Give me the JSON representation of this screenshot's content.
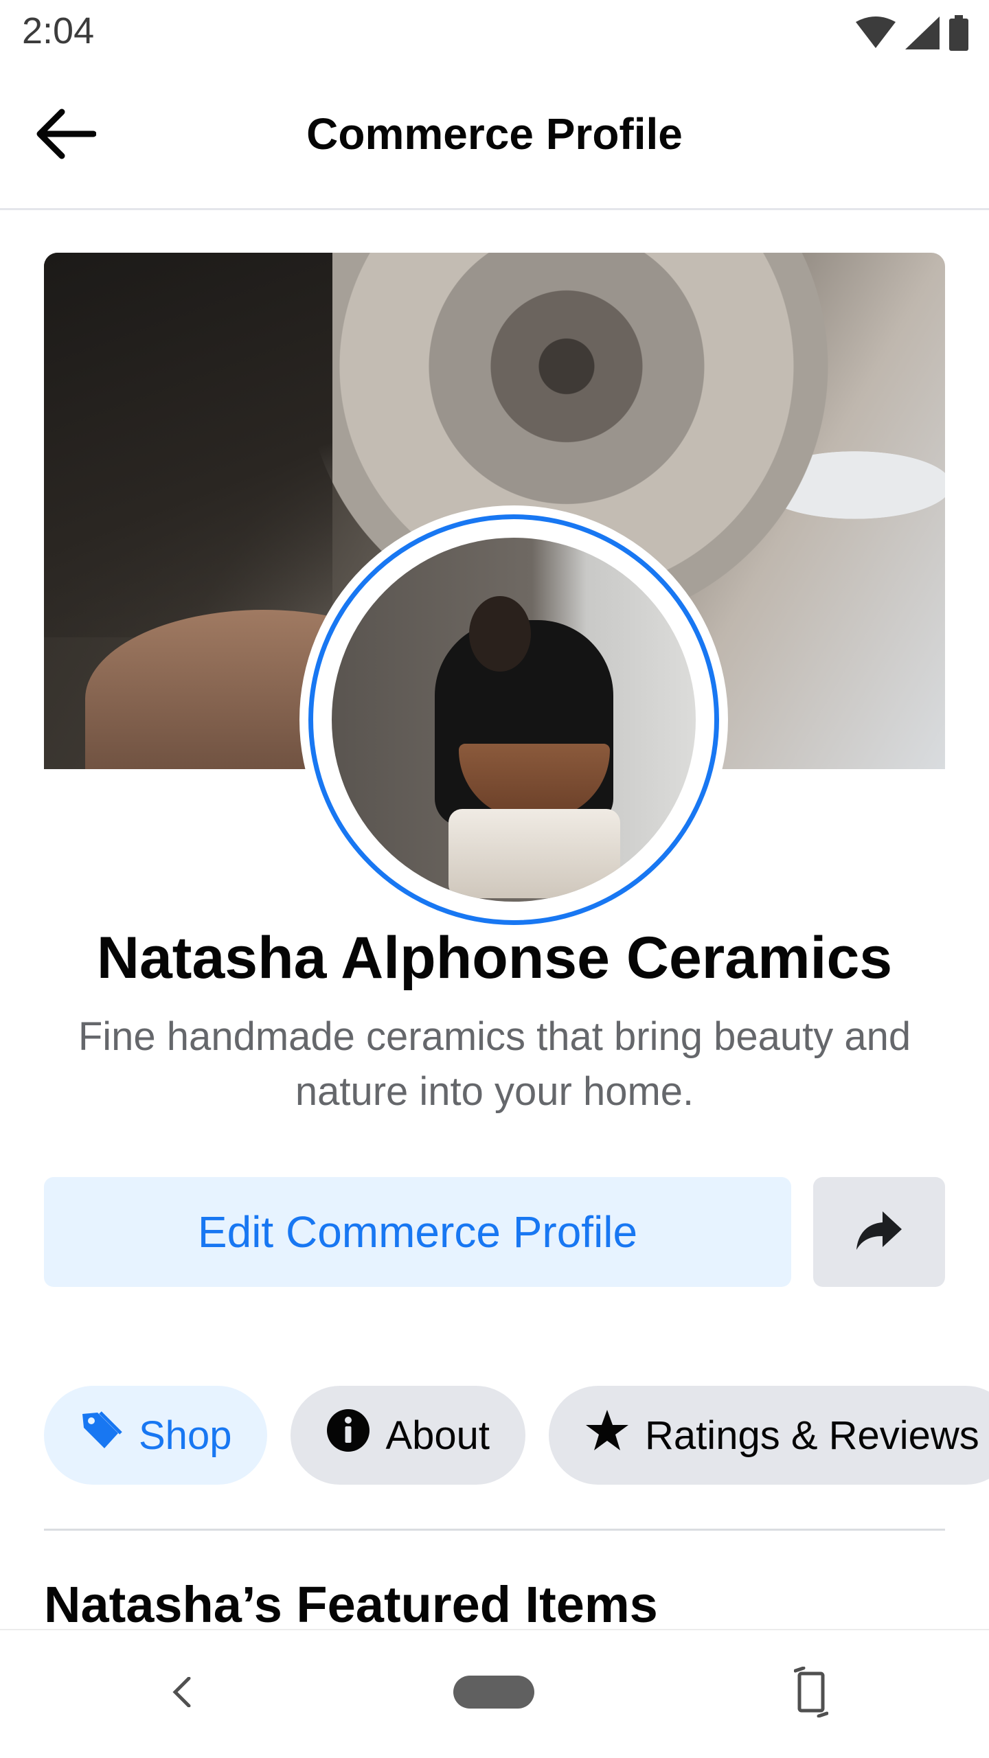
{
  "status_bar": {
    "time": "2:04",
    "icons": [
      "wifi-icon",
      "signal-icon",
      "battery-icon"
    ]
  },
  "app_bar": {
    "title": "Commerce Profile",
    "back_icon": "arrow-left-icon"
  },
  "profile": {
    "name": "Natasha Alphonse Ceramics",
    "description": "Fine handmade ceramics that bring beauty and nature into your home."
  },
  "actions": {
    "edit_label": "Edit Commerce Profile",
    "share_icon": "share-arrow-icon"
  },
  "tabs": [
    {
      "label": "Shop",
      "icon": "tag-icon",
      "active": true
    },
    {
      "label": "About",
      "icon": "info-icon",
      "active": false
    },
    {
      "label": "Ratings & Reviews",
      "icon": "star-icon",
      "active": false
    }
  ],
  "section": {
    "title": "Natasha’s Featured Items"
  },
  "colors": {
    "accent": "#1877f2",
    "accent_light": "#e7f3ff",
    "neutral_button": "#e4e6eb",
    "secondary_text": "#65676b"
  }
}
